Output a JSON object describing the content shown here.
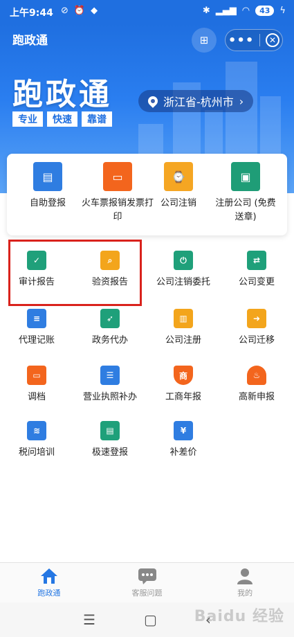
{
  "status_bar": {
    "time": "上午9:44",
    "battery": "43"
  },
  "header": {
    "title": "跑政通",
    "more_icon": "more-dots-icon",
    "close_icon": "close-circle-icon",
    "scan_icon": "scan-icon"
  },
  "banner": {
    "slogan": "跑政通",
    "tags": [
      "专业",
      "快速",
      "靠谱"
    ],
    "location": "浙江省-杭州市"
  },
  "top_services": [
    {
      "label": "自助登报",
      "icon": "newspaper-icon",
      "color": "#2f7de1"
    },
    {
      "label": "火车票报销发票打印",
      "icon": "train-icon",
      "color": "#f3651d"
    },
    {
      "label": "公司注销",
      "icon": "briefcase-clock-icon",
      "color": "#f5a623"
    },
    {
      "label": "注册公司 (免费送章)",
      "icon": "briefcase-icon",
      "color": "#1f9d77"
    }
  ],
  "services": [
    {
      "label": "审计报告",
      "icon": "clipboard-check-icon",
      "color": "#1fa07a"
    },
    {
      "label": "验资报告",
      "icon": "document-search-icon",
      "color": "#f3a51c"
    },
    {
      "label": "公司注销委托",
      "icon": "briefcase-power-icon",
      "color": "#1fa07a"
    },
    {
      "label": "公司变更",
      "icon": "transfer-doc-icon",
      "color": "#1fa07a"
    },
    {
      "label": "代理记账",
      "icon": "ledger-icon",
      "color": "#2f7de1"
    },
    {
      "label": "政务代办",
      "icon": "runner-icon",
      "color": "#1fa07a"
    },
    {
      "label": "公司注册",
      "icon": "building-icon",
      "color": "#f3a51c"
    },
    {
      "label": "公司迁移",
      "icon": "briefcase-move-icon",
      "color": "#f3a51c"
    },
    {
      "label": "调档",
      "icon": "id-card-icon",
      "color": "#f3651d"
    },
    {
      "label": "营业执照补办",
      "icon": "certificate-icon",
      "color": "#2f7de1"
    },
    {
      "label": "工商年报",
      "icon": "shield-badge-icon",
      "color": "#f3651d"
    },
    {
      "label": "高新申报",
      "icon": "flame-icon",
      "color": "#f3651d"
    },
    {
      "label": "税问培训",
      "icon": "layers-icon",
      "color": "#2f7de1"
    },
    {
      "label": "极速登报",
      "icon": "form-icon",
      "color": "#1fa07a"
    },
    {
      "label": "补差价",
      "icon": "yen-add-icon",
      "color": "#2f7de1"
    }
  ],
  "bottom_nav": [
    {
      "label": "跑政通",
      "icon": "home-icon",
      "active": true
    },
    {
      "label": "客服问题",
      "icon": "chat-icon",
      "active": false
    },
    {
      "label": "我的",
      "icon": "user-icon",
      "active": false
    }
  ],
  "watermark": "Baidu 经验"
}
